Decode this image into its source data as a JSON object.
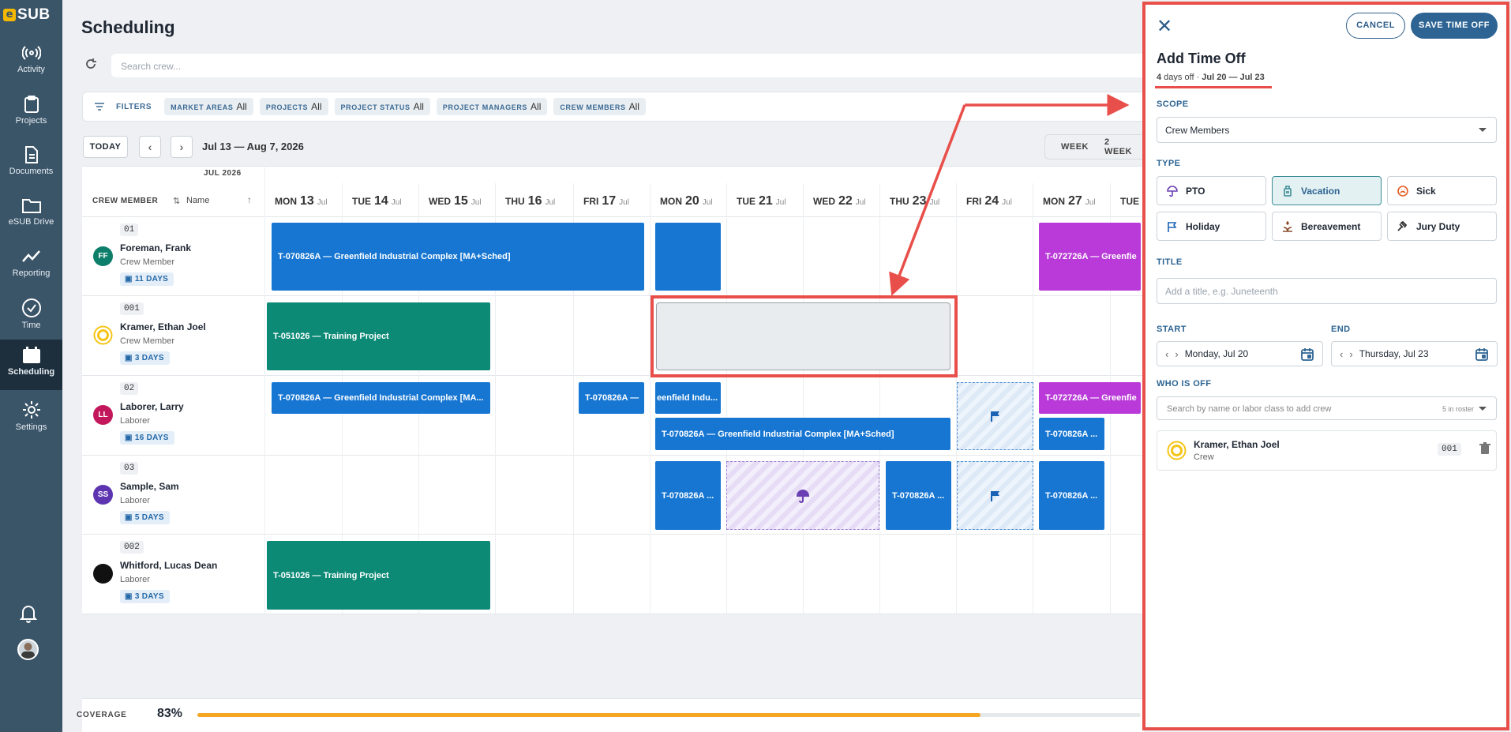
{
  "app": {
    "logo": "SUB",
    "logo_mark": "e"
  },
  "nav": [
    {
      "label": "Activity",
      "icon": "activity-icon"
    },
    {
      "label": "Projects",
      "icon": "clipboard-icon"
    },
    {
      "label": "Documents",
      "icon": "document-icon"
    },
    {
      "label": "eSUB Drive",
      "icon": "folder-icon"
    },
    {
      "label": "Reporting",
      "icon": "chart-icon"
    },
    {
      "label": "Time",
      "icon": "clock-icon"
    },
    {
      "label": "Scheduling",
      "icon": "calendar-icon",
      "active": true
    },
    {
      "label": "Settings",
      "icon": "gear-icon"
    }
  ],
  "page": {
    "title": "Scheduling"
  },
  "search": {
    "placeholder": "Search crew..."
  },
  "filters": {
    "label": "FILTERS",
    "chips": [
      {
        "key": "MARKET AREAS",
        "value": "All"
      },
      {
        "key": "PROJECTS",
        "value": "All"
      },
      {
        "key": "PROJECT STATUS",
        "value": "All"
      },
      {
        "key": "PROJECT MANAGERS",
        "value": "All"
      },
      {
        "key": "CREW MEMBERS",
        "value": "All"
      }
    ]
  },
  "toolbar": {
    "today": "TODAY",
    "prev": "‹",
    "next": "›",
    "range": "Jul 13 — Aug 7, 2026",
    "views": [
      "WEEK",
      "2 WEEK"
    ]
  },
  "grid": {
    "month": "JUL 2026",
    "crew_header": "CREW MEMBER",
    "name_header": "Name",
    "days": [
      {
        "dow": "MON",
        "num": "13",
        "mo": "Jul"
      },
      {
        "dow": "TUE",
        "num": "14",
        "mo": "Jul"
      },
      {
        "dow": "WED",
        "num": "15",
        "mo": "Jul"
      },
      {
        "dow": "THU",
        "num": "16",
        "mo": "Jul"
      },
      {
        "dow": "FRI",
        "num": "17",
        "mo": "Jul"
      },
      {
        "dow": "MON",
        "num": "20",
        "mo": "Jul"
      },
      {
        "dow": "TUE",
        "num": "21",
        "mo": "Jul"
      },
      {
        "dow": "WED",
        "num": "22",
        "mo": "Jul"
      },
      {
        "dow": "THU",
        "num": "23",
        "mo": "Jul"
      },
      {
        "dow": "FRI",
        "num": "24",
        "mo": "Jul"
      },
      {
        "dow": "MON",
        "num": "27",
        "mo": "Jul"
      },
      {
        "dow": "TUE",
        "num": "",
        "mo": ""
      }
    ],
    "crew": [
      {
        "code": "01",
        "name": "Foreman, Frank",
        "role": "Crew Member",
        "days": "11 DAYS",
        "initials": "FF",
        "color": "#0d7e6a"
      },
      {
        "code": "001",
        "name": "Kramer, Ethan Joel",
        "role": "Crew Member",
        "days": "3 DAYS",
        "initials": "",
        "color": "#f5c518"
      },
      {
        "code": "02",
        "name": "Laborer, Larry",
        "role": "Laborer",
        "days": "16 DAYS",
        "initials": "LL",
        "color": "#c2185b"
      },
      {
        "code": "03",
        "name": "Sample, Sam",
        "role": "Laborer",
        "days": "5 DAYS",
        "initials": "SS",
        "color": "#5e35b1"
      },
      {
        "code": "002",
        "name": "Whitford, Lucas Dean",
        "role": "Laborer",
        "days": "3 DAYS",
        "initials": "",
        "color": "#111111"
      }
    ],
    "bars": {
      "b1": "T-070826A — Greenfield Industrial Complex [MA+Sched]",
      "b2": "T-072726A — Greenfie",
      "b3": "T-051026 — Training Project",
      "b4": "T-070826A — Greenfield Industrial Complex [MA...",
      "b5": "T-070826A —",
      "b6": "eenfield Indu...",
      "b7": "T-072726A — Greenfie",
      "b8": "T-070826A — Greenfield Industrial Complex [MA+Sched]",
      "b9": "T-070826A ...",
      "b10": "T-070826A ...",
      "b11": "T-070826A ...",
      "b12": "T-070826A ...",
      "b13": "T-051026 — Training Project"
    }
  },
  "coverage": {
    "label": "COVERAGE",
    "value": "83%",
    "fraction": 0.83
  },
  "panel": {
    "cancel": "CANCEL",
    "save": "SAVE TIME OFF",
    "title": "Add Time Off",
    "sub_days": "4",
    "sub_days_text": " days off · ",
    "sub_range": "Jul 20 — Jul 23",
    "scope_label": "SCOPE",
    "scope_value": "Crew Members",
    "type_label": "TYPE",
    "types": [
      {
        "label": "PTO",
        "icon": "umbrella-icon"
      },
      {
        "label": "Vacation",
        "icon": "luggage-icon",
        "selected": true
      },
      {
        "label": "Sick",
        "icon": "sick-icon"
      },
      {
        "label": "Holiday",
        "icon": "flag-icon"
      },
      {
        "label": "Bereavement",
        "icon": "candle-icon"
      },
      {
        "label": "Jury Duty",
        "icon": "gavel-icon"
      }
    ],
    "title_label": "TITLE",
    "title_placeholder": "Add a title, e.g. Juneteenth",
    "start_label": "START",
    "start_value": "Monday, Jul 20",
    "end_label": "END",
    "end_value": "Thursday, Jul 23",
    "who_label": "WHO IS OFF",
    "who_placeholder": "Search by name or labor class to add crew",
    "roster": "5 in roster",
    "person": {
      "name": "Kramer, Ethan Joel",
      "sub": "Crew",
      "code": "001"
    }
  }
}
